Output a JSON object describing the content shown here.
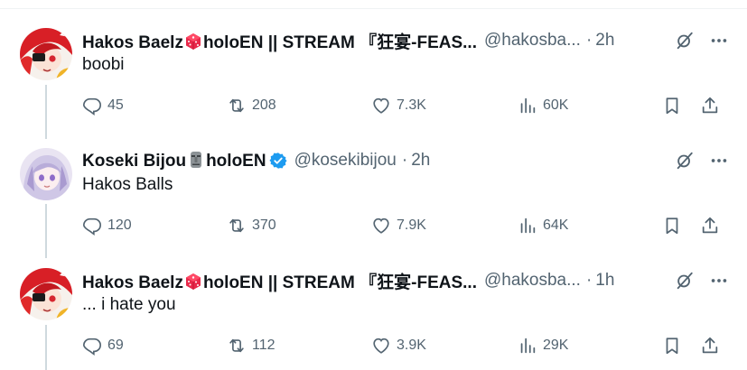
{
  "tweets": [
    {
      "name": "Hakos Baelz",
      "name_suffix": "holoEN || STREAM 『狂宴-FEAS...",
      "handle": "@hakosba...",
      "time": "2h",
      "text": "boobi",
      "replies": "45",
      "retweets": "208",
      "likes": "7.3K",
      "views": "60K"
    },
    {
      "name": "Koseki Bijou",
      "name_suffix": "holoEN",
      "handle": "@kosekibijou",
      "time": "2h",
      "text": "Hakos Balls",
      "replies": "120",
      "retweets": "370",
      "likes": "7.9K",
      "views": "64K"
    },
    {
      "name": "Hakos Baelz",
      "name_suffix": "holoEN || STREAM 『狂宴-FEAS...",
      "handle": "@hakosba...",
      "time": "1h",
      "text": "... i hate you",
      "replies": "69",
      "retweets": "112",
      "likes": "3.9K",
      "views": "29K"
    }
  ],
  "colors": {
    "text_primary": "#0f1419",
    "text_secondary": "#536471",
    "verified_blue": "#1d9bf0",
    "thread_line": "#cfd9de"
  },
  "icons": [
    "reply-icon",
    "retweet-icon",
    "like-icon",
    "views-icon",
    "bookmark-icon",
    "share-icon",
    "grok-icon",
    "more-icon",
    "dice-emoji",
    "moai-emoji",
    "verified-badge-icon"
  ]
}
